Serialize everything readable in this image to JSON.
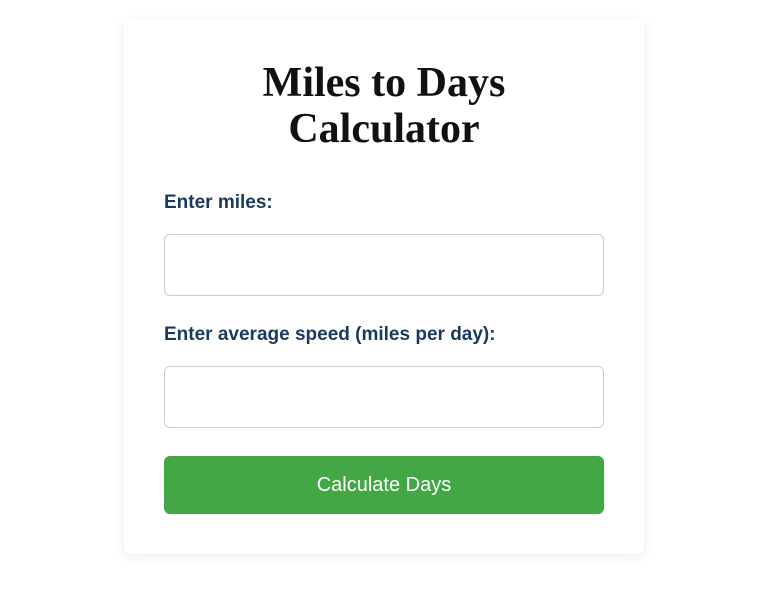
{
  "title": "Miles to Days Calculator",
  "form": {
    "miles_label": "Enter miles:",
    "miles_value": "",
    "speed_label": "Enter average speed (miles per day):",
    "speed_value": "",
    "submit_label": "Calculate Days"
  },
  "colors": {
    "accent": "#42a744",
    "label_text": "#1c3a5b"
  }
}
